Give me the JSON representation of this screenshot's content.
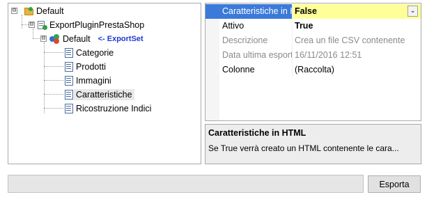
{
  "tree": {
    "root": {
      "label": "Default",
      "expander": "⊟"
    },
    "plugin": {
      "label": "ExportPluginPrestaShop",
      "expander": "⊟"
    },
    "exportset": {
      "label": "Default",
      "annotation": "<- ExportSet",
      "expander": "⊟"
    },
    "children": [
      {
        "label": "Categorie"
      },
      {
        "label": "Prodotti"
      },
      {
        "label": "Immagini"
      },
      {
        "label": "Caratteristiche",
        "selected": true
      },
      {
        "label": "Ricostruzione Indici"
      }
    ]
  },
  "properties": {
    "rows": [
      {
        "name": "Caratteristiche in HTML",
        "value": "False",
        "selected": true
      },
      {
        "name": "Attivo",
        "value": "True"
      },
      {
        "name": "Descrizione",
        "value": "Crea un file CSV contenente",
        "disabled": true
      },
      {
        "name": "Data ultima esportazione",
        "value": "16/11/2016 12:51",
        "disabled": true
      },
      {
        "name": "Colonne",
        "value": "(Raccolta)"
      }
    ],
    "dropdown_glyph": "⌄"
  },
  "help": {
    "title": "Caratteristiche in HTML",
    "description": "Se True verrà creato un HTML contenente le cara..."
  },
  "footer": {
    "export_label": "Esporta"
  },
  "colors": {
    "selection_blue": "#3b7ad9",
    "value_highlight": "#ffff99",
    "annotation_blue": "#1f3ad1"
  }
}
